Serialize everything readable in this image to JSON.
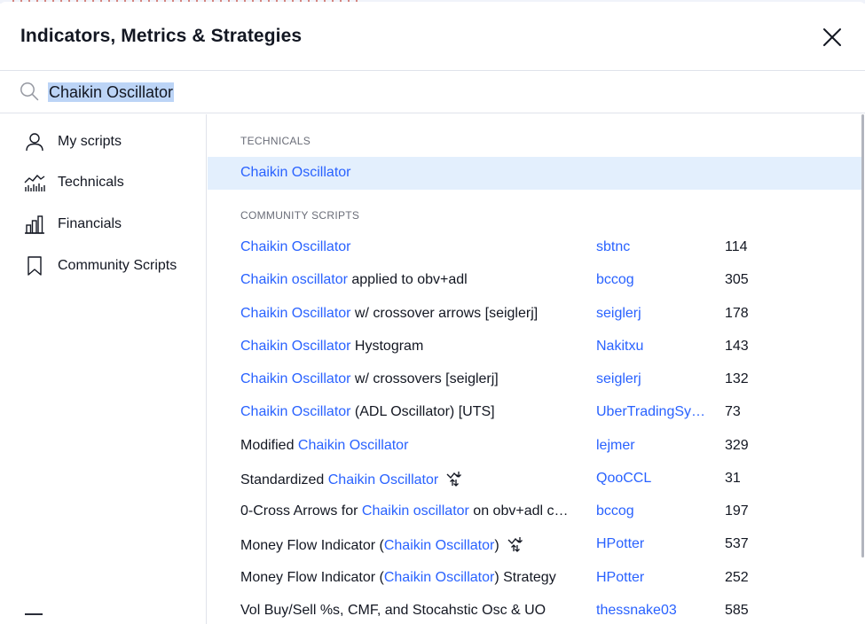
{
  "dialog": {
    "title": "Indicators, Metrics & Strategies",
    "close_icon": "close-icon"
  },
  "search": {
    "value": "Chaikin Oscillator",
    "icon": "search-icon"
  },
  "sidebar": {
    "items": [
      {
        "label": "My scripts",
        "icon": "user-icon"
      },
      {
        "label": "Technicals",
        "icon": "technicals-chart-icon"
      },
      {
        "label": "Financials",
        "icon": "bar-chart-icon"
      },
      {
        "label": "Community Scripts",
        "icon": "bookmark-icon"
      }
    ]
  },
  "sections": {
    "technicals_label": "TECHNICALS",
    "community_label": "COMMUNITY SCRIPTS"
  },
  "technicals": [
    {
      "pre": "",
      "hl": "Chaikin Oscillator",
      "post": ""
    }
  ],
  "community_scripts": [
    {
      "pre": "",
      "hl": "Chaikin Oscillator",
      "post": "",
      "author": "sbtnc",
      "likes": "114",
      "badge": false
    },
    {
      "pre": "",
      "hl": "Chaikin oscillator",
      "post": " applied to obv+adl",
      "author": "bccog",
      "likes": "305",
      "badge": false
    },
    {
      "pre": "",
      "hl": "Chaikin Oscillator",
      "post": " w/ crossover arrows [seiglerj]",
      "author": "seiglerj",
      "likes": "178",
      "badge": false
    },
    {
      "pre": "",
      "hl": "Chaikin Oscillator",
      "post": " Hystogram",
      "author": "Nakitxu",
      "likes": "143",
      "badge": false
    },
    {
      "pre": "",
      "hl": "Chaikin Oscillator",
      "post": " w/ crossovers [seiglerj]",
      "author": "seiglerj",
      "likes": "132",
      "badge": false
    },
    {
      "pre": "",
      "hl": "Chaikin Oscillator",
      "post": " (ADL Oscillator) [UTS]",
      "author": "UberTradingSy…",
      "likes": "73",
      "badge": false
    },
    {
      "pre": "Modified ",
      "hl": "Chaikin Oscillator",
      "post": "",
      "author": "lejmer",
      "likes": "329",
      "badge": false
    },
    {
      "pre": "Standardized ",
      "hl": "Chaikin Oscillator",
      "post": "",
      "author": "QooCCL",
      "likes": "31",
      "badge": true
    },
    {
      "pre": "0-Cross Arrows for ",
      "hl": "Chaikin oscillator",
      "post": " on obv+adl c…",
      "author": "bccog",
      "likes": "197",
      "badge": false
    },
    {
      "pre": "Money Flow Indicator (",
      "hl": "Chaikin Oscillator",
      "post": ")",
      "author": "HPotter",
      "likes": "537",
      "badge": true
    },
    {
      "pre": "Money Flow Indicator (",
      "hl": "Chaikin Oscillator",
      "post": ") Strategy",
      "author": "HPotter",
      "likes": "252",
      "badge": false
    },
    {
      "pre": "Vol Buy/Sell %s, CMF, and Stocahstic Osc & UO",
      "hl": "",
      "post": "",
      "author": "thessnake03",
      "likes": "585",
      "badge": false
    }
  ],
  "badge_icon": "strategy-arrows-icon",
  "colors": {
    "accent": "#2962ff",
    "selected_row": "#e3effd",
    "search_highlight": "#bcd4f6",
    "muted_text": "#6a6d78",
    "border": "#e0e3eb"
  }
}
